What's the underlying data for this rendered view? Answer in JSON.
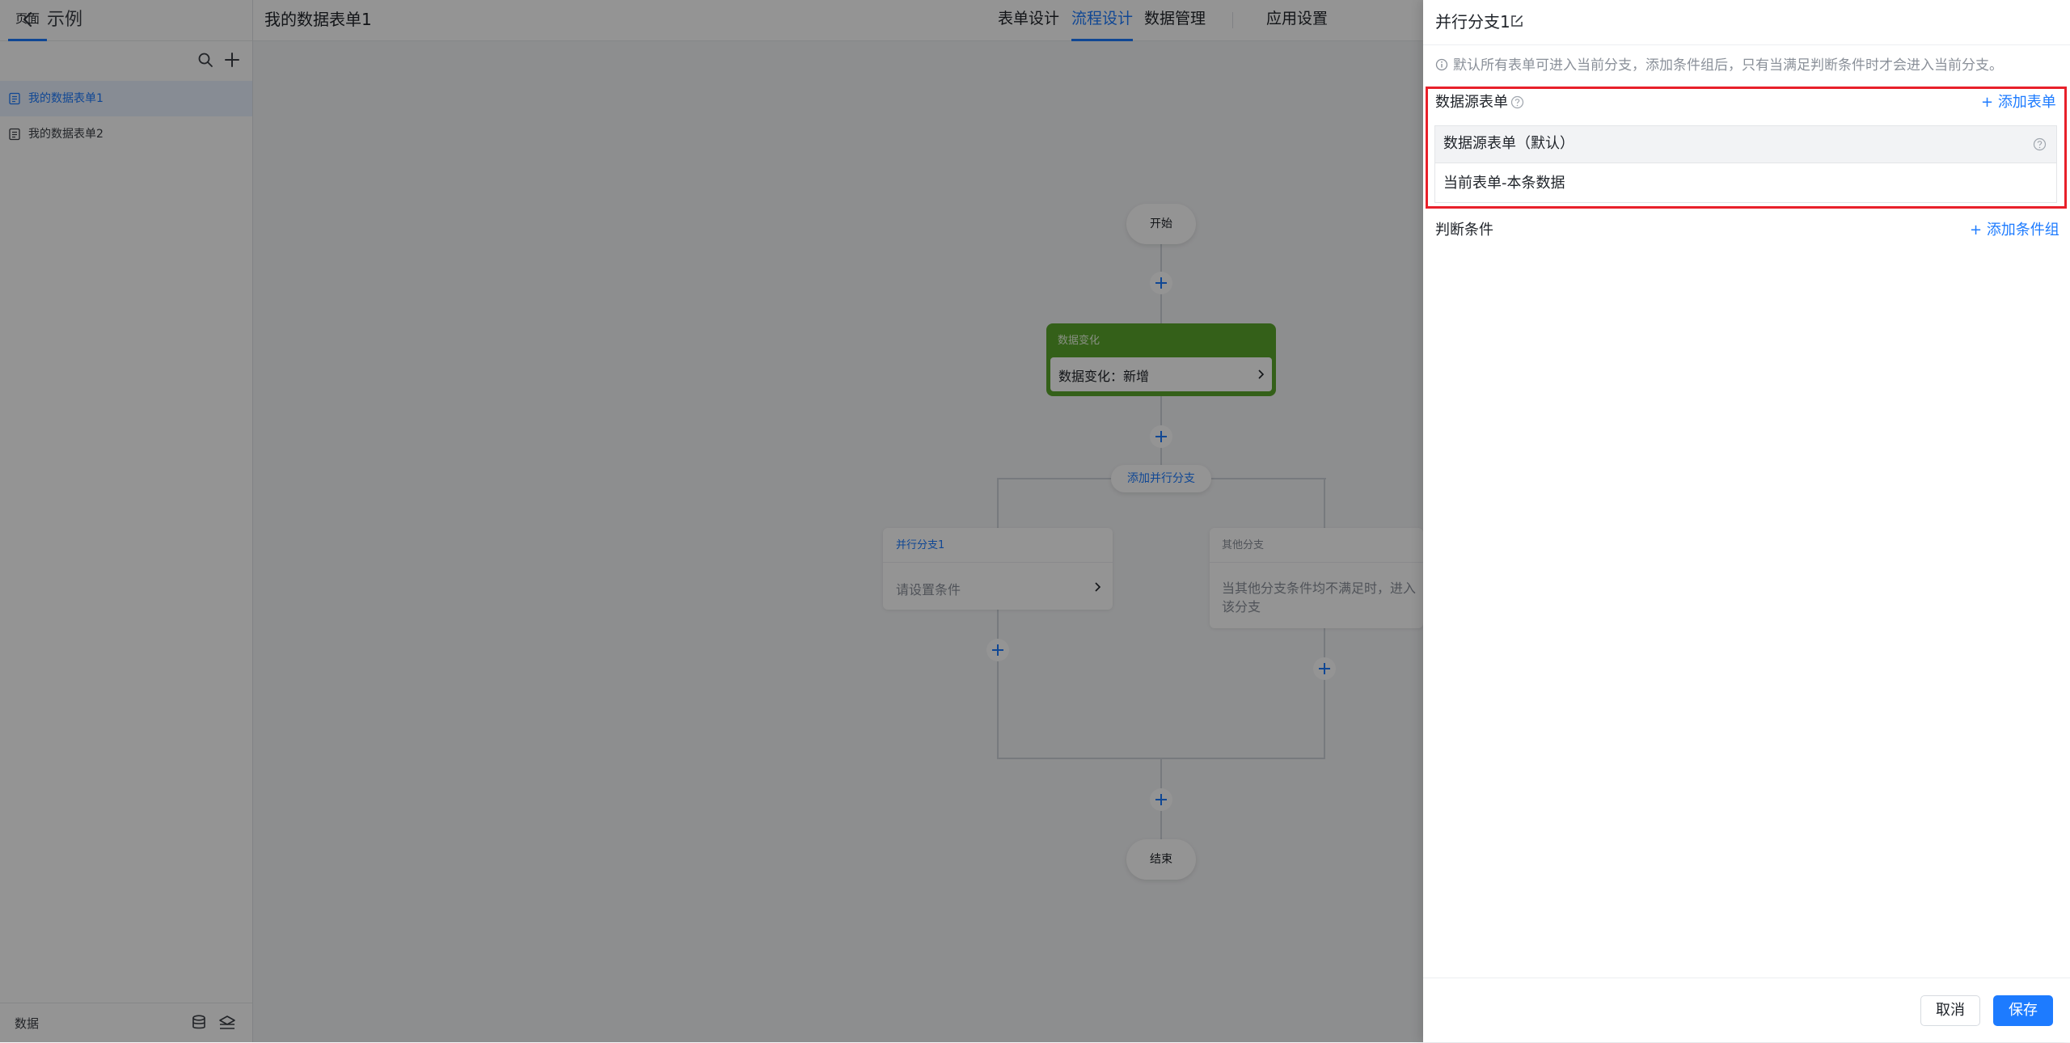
{
  "sidebar": {
    "app_name": "示例",
    "tab": "页面",
    "pages": [
      "我的数据表单1",
      "我的数据表单2"
    ],
    "bottom_label": "数据"
  },
  "header": {
    "form_title": "我的数据表单1",
    "tabs": [
      "表单设计",
      "流程设计",
      "数据管理",
      "应用设置"
    ],
    "active_tab": "流程设计"
  },
  "flow": {
    "start": "开始",
    "trigger_title": "数据变化",
    "trigger_text": "数据变化：新增",
    "add_branch": "添加并行分支",
    "branch1_title": "并行分支1",
    "branch1_text": "请设置条件",
    "branch2_title": "其他分支",
    "branch2_text": "当其他分支条件均不满足时，进入该分支",
    "end": "结束"
  },
  "drawer": {
    "title": "并行分支1",
    "info": "默认所有表单可进入当前分支，添加条件组后，只有当满足判断条件时才会进入当前分支。",
    "data_source_label": "数据源表单",
    "add_form": "添加表单",
    "table_header": "数据源表单（默认）",
    "table_row": "当前表单-本条数据",
    "condition_label": "判断条件",
    "add_condition_group": "添加条件组",
    "cancel": "取消",
    "save": "保存"
  },
  "colors": {
    "primary": "#1d7bff",
    "trigger_green": "#5aa52c",
    "highlight_red": "#e8202a",
    "overlay": "rgba(0,0,0,0.42)"
  }
}
